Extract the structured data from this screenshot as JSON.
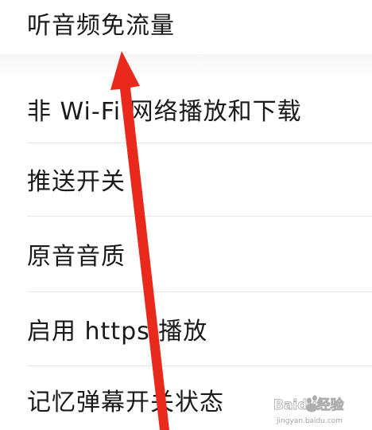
{
  "settings": {
    "items": [
      {
        "label": "听音频免流量"
      },
      {
        "label": "非 Wi-Fi 网络播放和下载"
      },
      {
        "label": "推送开关"
      },
      {
        "label": "原音音质"
      },
      {
        "label": "启用 https 播放"
      },
      {
        "label": "记忆弹幕开关状态"
      }
    ]
  },
  "annotation": {
    "arrow_color": "#e8291c"
  },
  "watermark": {
    "brand": "Baidu经验",
    "url": "jingyan.baidu.com"
  }
}
